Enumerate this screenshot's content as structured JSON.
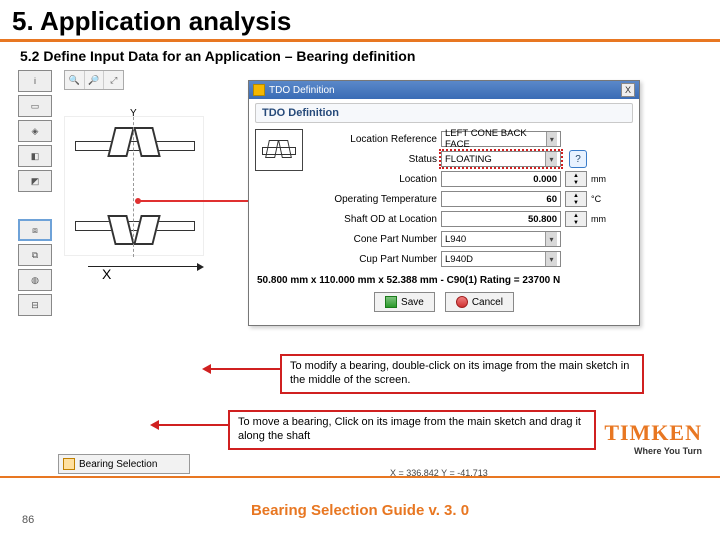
{
  "slide": {
    "title": "5. Application analysis",
    "subtitle": "5.2 Define Input Data for an Application – Bearing definition",
    "page_number": "86",
    "footer_title": "Bearing Selection Guide v. 3. 0"
  },
  "branding": {
    "logo_name": "TIMKEN",
    "logo_tagline": "Where You Turn"
  },
  "dialog": {
    "window_title": "TDO Definition",
    "section_title": "TDO Definition",
    "fields": {
      "location_ref_label": "Location Reference",
      "location_ref_value": "LEFT CONE BACK FACE",
      "status_label": "Status",
      "status_value": "FLOATING",
      "location_label": "Location",
      "location_value": "0.000",
      "location_unit": "mm",
      "op_temp_label": "Operating Temperature",
      "op_temp_value": "60",
      "op_temp_unit": "°C",
      "shaft_od_label": "Shaft OD at Location",
      "shaft_od_value": "50.800",
      "shaft_od_unit": "mm",
      "cone_pn_label": "Cone Part Number",
      "cone_pn_value": "L940",
      "cup_pn_label": "Cup Part Number",
      "cup_pn_value": "L940D"
    },
    "spec_line": "50.800 mm x 110.000 mm x 52.388 mm - C90(1) Rating = 23700 N",
    "buttons": {
      "save": "Save",
      "cancel": "Cancel"
    }
  },
  "callouts": {
    "modify": "To modify a bearing, double-click on its image from the main sketch in the middle of the screen.",
    "move": "To move a bearing, Click on its image from the main sketch and drag it along the shaft"
  },
  "bottom_toolbar": {
    "bearing_selection": "Bearing Selection",
    "coords": "X = 336.842 Y = -41.713"
  },
  "sketch": {
    "x_axis_label": "X",
    "y_axis_label": "Y"
  },
  "icons": {
    "close": "X",
    "help": "?",
    "dropdown": "▾",
    "up": "▲",
    "down": "▼"
  }
}
